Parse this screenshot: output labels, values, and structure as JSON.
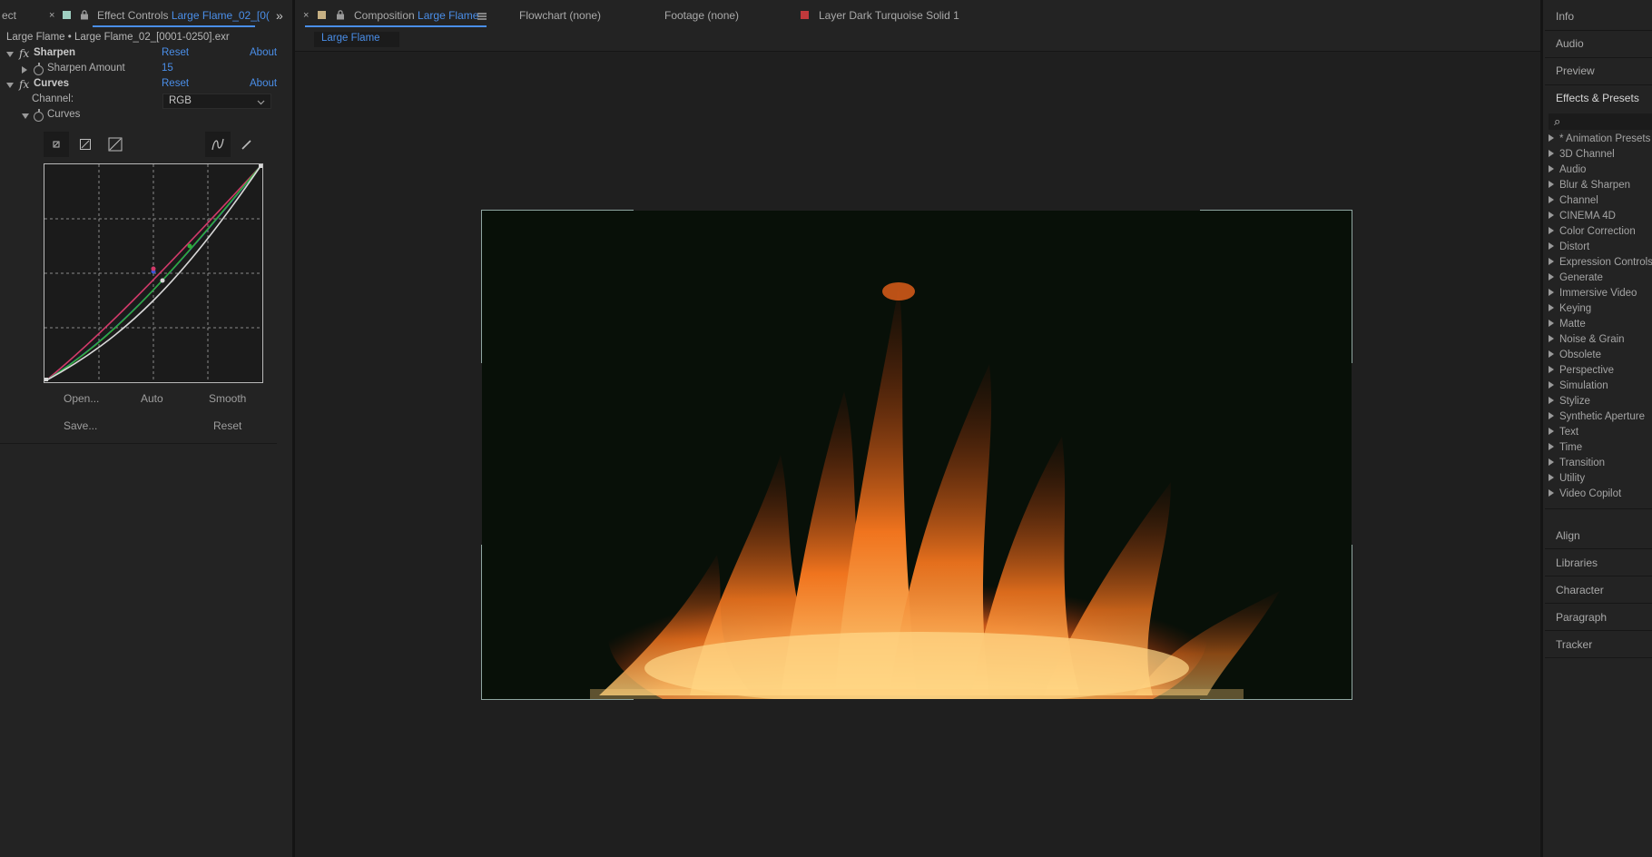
{
  "effect_controls": {
    "cut_tab_label": "ect",
    "close_glyph": "×",
    "tab_prefix": "Effect Controls",
    "tab_layer": "Large Flame_02_[0(",
    "source_line": "Large Flame • Large Flame_02_[0001-0250].exr",
    "effects": [
      {
        "name": "Sharpen",
        "reset": "Reset",
        "about": "About"
      },
      {
        "name": "Curves",
        "reset": "Reset",
        "about": "About"
      }
    ],
    "sharpen_amount_label": "Sharpen Amount",
    "sharpen_amount_value": "15",
    "channel_label": "Channel:",
    "channel_value": "RGB",
    "curves_label": "Curves",
    "buttons": {
      "open": "Open...",
      "auto": "Auto",
      "smooth": "Smooth",
      "save": "Save...",
      "reset": "Reset"
    }
  },
  "composition": {
    "tab_prefix": "Composition",
    "tab_name": "Large Flame",
    "subtab": "Large Flame",
    "flowchart_tab": "Flowchart  (none)",
    "footage_tab": "Footage  (none)",
    "layer_tab_prefix": "Layer",
    "layer_tab_name": "Dark Turquoise Solid 1",
    "layer_color": "#c0393b"
  },
  "right_panels": {
    "info": "Info",
    "audio": "Audio",
    "preview": "Preview",
    "effects_presets": "Effects & Presets",
    "search_glyph": "⌕",
    "categories": [
      "* Animation Presets",
      "3D Channel",
      "Audio",
      "Blur & Sharpen",
      "Channel",
      "CINEMA 4D",
      "Color Correction",
      "Distort",
      "Expression Controls",
      "Generate",
      "Immersive Video",
      "Keying",
      "Matte",
      "Noise & Grain",
      "Obsolete",
      "Perspective",
      "Simulation",
      "Stylize",
      "Synthetic Aperture",
      "Text",
      "Time",
      "Transition",
      "Utility",
      "Video Copilot"
    ],
    "align": "Align",
    "libraries": "Libraries",
    "character": "Character",
    "paragraph": "Paragraph",
    "tracker": "Tracker"
  },
  "colors": {
    "accent_blue": "#4a8ee8",
    "panel_bg": "#232323",
    "viewer_bg": "#081008"
  }
}
